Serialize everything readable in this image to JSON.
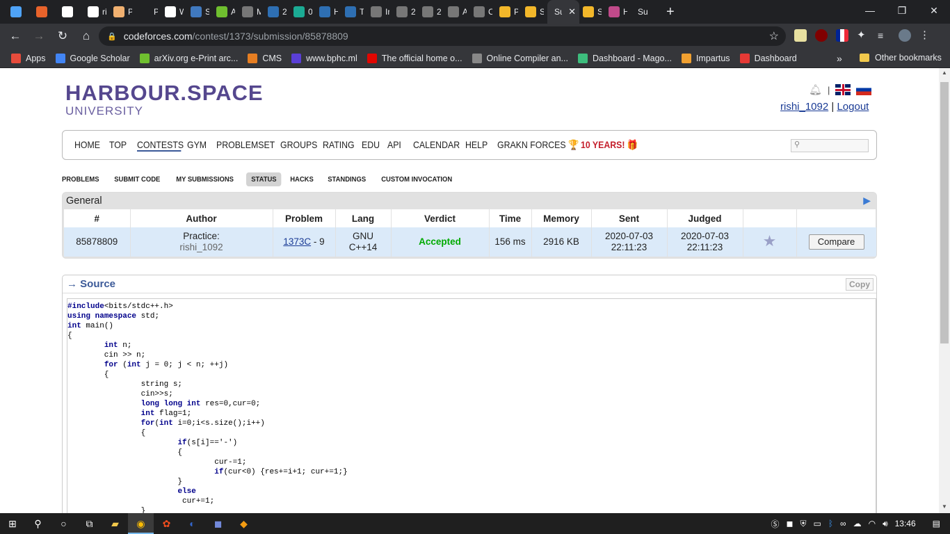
{
  "browser": {
    "tabs": [
      {
        "label": "",
        "icon": "circle-app-icon",
        "color": "#4fa3f7"
      },
      {
        "label": "",
        "icon": "sc-icon",
        "color": "#e8632b"
      },
      {
        "label": "",
        "icon": "github-icon",
        "color": "#ffffff"
      },
      {
        "label": "ri",
        "icon": "github-icon",
        "color": "#ffffff"
      },
      {
        "label": "P",
        "icon": "document-icon",
        "color": "#f0b070"
      },
      {
        "label": "P",
        "icon": "blank-icon",
        "color": "#202124"
      },
      {
        "label": "W",
        "icon": "db-icon",
        "color": "#ffffff"
      },
      {
        "label": "S",
        "icon": "ieee-icon",
        "color": "#4079bf"
      },
      {
        "label": "A",
        "icon": "smiley-icon",
        "color": "#6fbf2f"
      },
      {
        "label": "M",
        "icon": "globe-icon",
        "color": "#777777"
      },
      {
        "label": "2",
        "icon": "code-icon",
        "color": "#2e6fb3"
      },
      {
        "label": "0",
        "icon": "r-icon",
        "color": "#1bab94"
      },
      {
        "label": "H",
        "icon": "code-icon",
        "color": "#2e6fb3"
      },
      {
        "label": "T",
        "icon": "code-icon",
        "color": "#2e6fb3"
      },
      {
        "label": "Ir",
        "icon": "globe-icon",
        "color": "#777777"
      },
      {
        "label": "2",
        "icon": "globe-icon",
        "color": "#777777"
      },
      {
        "label": "2",
        "icon": "globe-icon",
        "color": "#777777"
      },
      {
        "label": "A",
        "icon": "globe-icon",
        "color": "#777777"
      },
      {
        "label": "C",
        "icon": "globe-icon",
        "color": "#777777"
      },
      {
        "label": "P",
        "icon": "codeforces-icon",
        "color": "#f2b72a"
      },
      {
        "label": "S",
        "icon": "codeforces-icon",
        "color": "#f2b72a"
      },
      {
        "label": "Su",
        "icon": "",
        "color": "",
        "active": true
      },
      {
        "label": "S",
        "icon": "codeforces-icon",
        "color": "#f2b72a"
      },
      {
        "label": "H",
        "icon": "hs-icon",
        "color": "#c04a8a"
      },
      {
        "label": "Su",
        "icon": "",
        "color": ""
      }
    ],
    "new_tab": "+",
    "url_host": "codeforces.com",
    "url_path": "/contest/1373/submission/85878809",
    "bookmarks": [
      {
        "label": "Apps",
        "icon": "apps-icon",
        "color": "#e74c3c"
      },
      {
        "label": "Google Scholar",
        "icon": "scholar-icon",
        "color": "#4285f4"
      },
      {
        "label": "arXiv.org e-Print arc...",
        "icon": "smiley-icon",
        "color": "#6fbf2f"
      },
      {
        "label": "CMS",
        "icon": "cms-icon",
        "color": "#e67e22"
      },
      {
        "label": "www.bphc.ml",
        "icon": "i-icon",
        "color": "#5a3fd6"
      },
      {
        "label": "The official home o...",
        "icon": "f1-icon",
        "color": "#e10600"
      },
      {
        "label": "Online Compiler an...",
        "icon": "jdoodle-icon",
        "color": "#888888"
      },
      {
        "label": "Dashboard - Mago...",
        "icon": "mago-icon",
        "color": "#3dbd7d"
      },
      {
        "label": "Impartus",
        "icon": "impartus-icon",
        "color": "#f0a030"
      },
      {
        "label": "Dashboard",
        "icon": "dashboard-icon",
        "color": "#e53935"
      }
    ],
    "bookmarks_more": "»",
    "other_bookmarks": "Other bookmarks"
  },
  "header": {
    "logo_line1": "HARBOUR.SPACE",
    "logo_line2": "UNIVERSITY",
    "username": "rishi_1092",
    "separator": "|",
    "logout": "Logout"
  },
  "menu": [
    {
      "label": "HOME"
    },
    {
      "label": "TOP"
    },
    {
      "label": "CONTESTS",
      "active": true
    },
    {
      "label": "GYM"
    },
    {
      "label": "PROBLEMSET"
    },
    {
      "label": "GROUPS"
    },
    {
      "label": "RATING"
    },
    {
      "label": "EDU"
    },
    {
      "label": "API"
    },
    {
      "label": "CALENDAR"
    },
    {
      "label": "HELP"
    },
    {
      "label": "GRAKN FORCES 🏆"
    },
    {
      "label": "10 YEARS! 🎁",
      "red": true
    }
  ],
  "submenu": [
    {
      "label": "PROBLEMS"
    },
    {
      "label": "SUBMIT CODE"
    },
    {
      "label": "MY SUBMISSIONS"
    },
    {
      "label": "STATUS",
      "active": true
    },
    {
      "label": "HACKS"
    },
    {
      "label": "STANDINGS"
    },
    {
      "label": "CUSTOM INVOCATION"
    }
  ],
  "status": {
    "caption": "General",
    "columns": [
      "#",
      "Author",
      "Problem",
      "Lang",
      "Verdict",
      "Time",
      "Memory",
      "Sent",
      "Judged",
      "",
      ""
    ],
    "row": {
      "id": "85878809",
      "author_prefix": "Practice:",
      "author": "rishi_1092",
      "problem_link": "1373C",
      "problem_suffix": "- 9",
      "lang_line1": "GNU",
      "lang_line2": "C++14",
      "verdict": "Accepted",
      "time": "156 ms",
      "memory": "2916 KB",
      "sent_date": "2020-07-03",
      "sent_time": "22:11:23",
      "judged_date": "2020-07-03",
      "judged_time": "22:11:23",
      "compare": "Compare"
    }
  },
  "source": {
    "title": "→ Source",
    "copy": "Copy",
    "lines": [
      "#include<bits/stdc++.h>",
      "using namespace std;",
      "int main()",
      "{",
      "        int n;",
      "        cin >> n;",
      "        for (int j = 0; j < n; ++j)",
      "        {",
      "                string s;",
      "                cin>>s;",
      "                long long int res=0,cur=0;",
      "                int flag=1;",
      "                for(int i=0;i<s.size();i++)",
      "                {",
      "                        if(s[i]=='-')",
      "                        {",
      "                                cur-=1;",
      "                                if(cur<0) {res+=i+1; cur+=1;}",
      "                        }",
      "                        else",
      "                         cur+=1;",
      "                }"
    ]
  },
  "taskbar": {
    "clock": "13:46"
  }
}
